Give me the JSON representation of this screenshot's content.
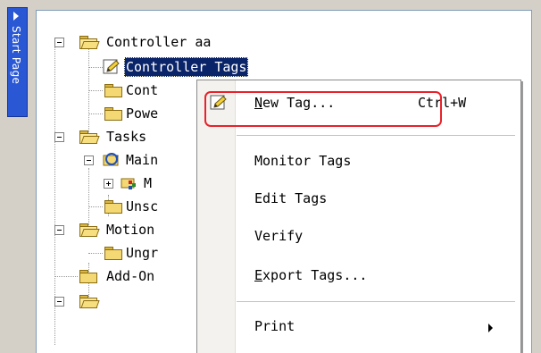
{
  "side_tab": {
    "label": "Start Page"
  },
  "tree": {
    "controller": "Controller aa",
    "controller_tags": "Controller Tags",
    "cont": "Cont",
    "powe": "Powe",
    "tasks": "Tasks",
    "main": "Main",
    "m": "M",
    "unsc": "Unsc",
    "motion": "Motion",
    "ungr": "Ungr",
    "addon": "Add-On"
  },
  "context_menu": {
    "new_tag_underlined": "N",
    "new_tag_rest": "ew Tag...",
    "new_tag_shortcut": "Ctrl+W",
    "monitor_tags": "Monitor Tags",
    "edit_tags": "Edit Tags",
    "verify": "Verify",
    "export_underlined": "E",
    "export_rest": "xport Tags...",
    "print": "Print"
  },
  "colors": {
    "selection": "#0a246a",
    "side_tab": "#2a57d4",
    "highlight": "#e8222b"
  }
}
